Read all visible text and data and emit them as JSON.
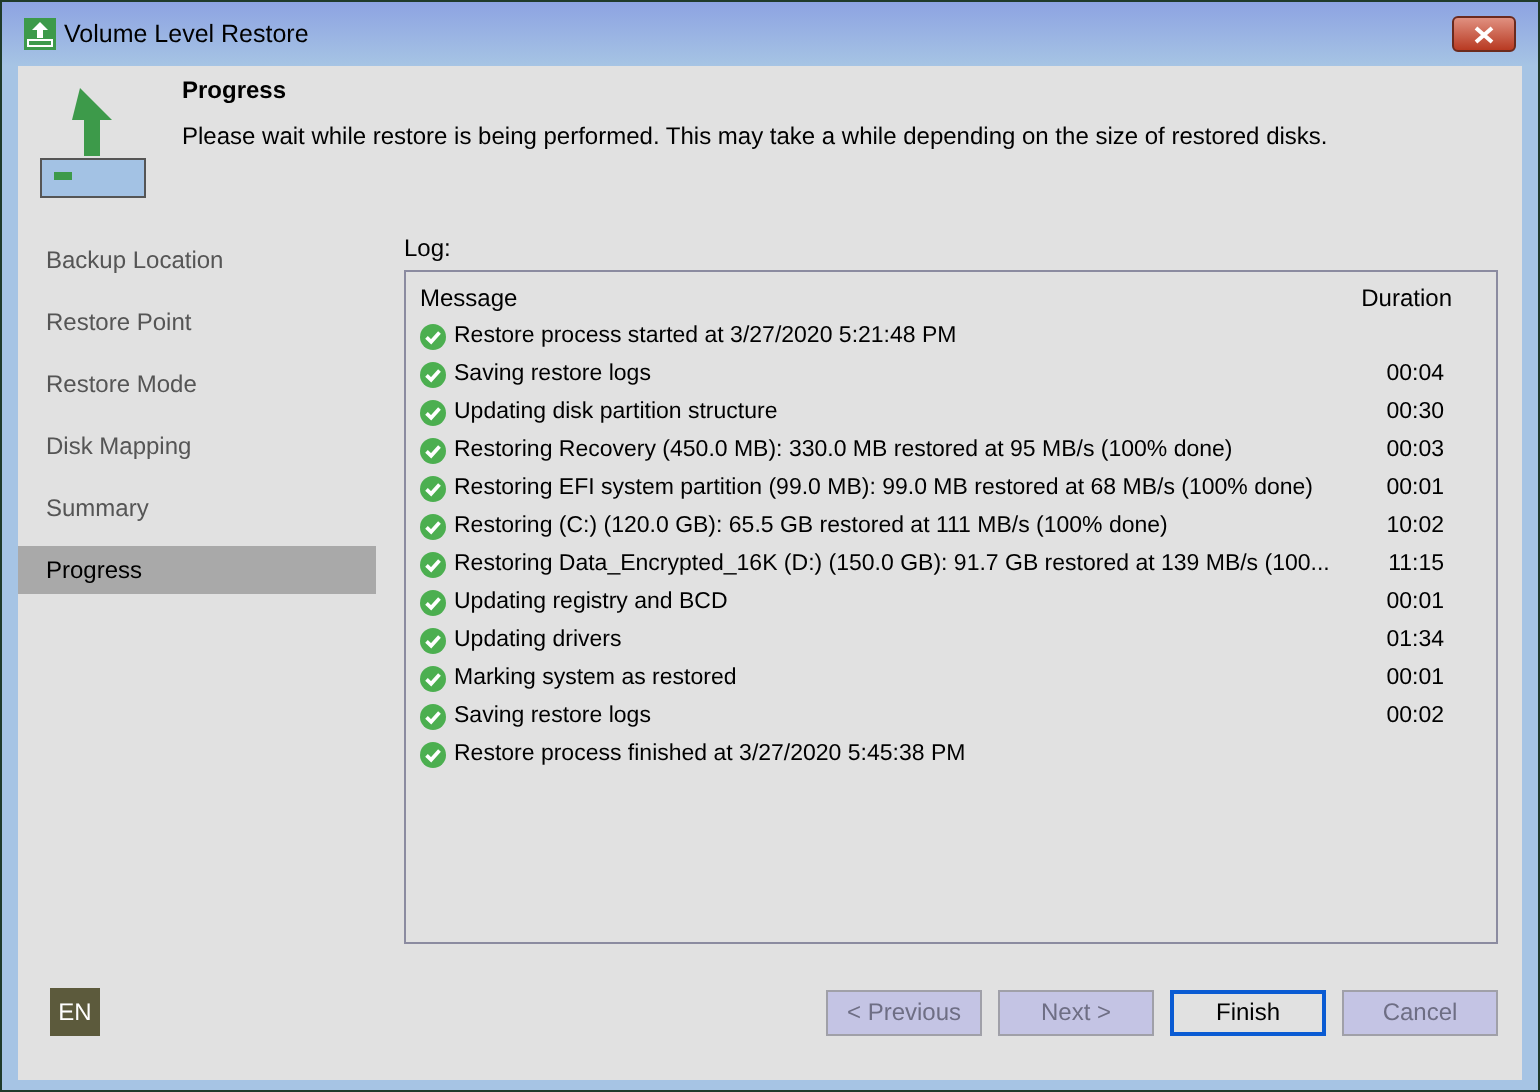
{
  "window": {
    "title": "Volume Level Restore"
  },
  "header": {
    "title": "Progress",
    "subtitle": "Please wait while restore is being performed. This may take a while depending on the size of restored disks."
  },
  "steps": [
    {
      "label": "Backup Location",
      "selected": false
    },
    {
      "label": "Restore Point",
      "selected": false
    },
    {
      "label": "Restore Mode",
      "selected": false
    },
    {
      "label": "Disk Mapping",
      "selected": false
    },
    {
      "label": "Summary",
      "selected": false
    },
    {
      "label": "Progress",
      "selected": true
    }
  ],
  "log": {
    "label": "Log:",
    "columns": [
      "Message",
      "Duration"
    ],
    "rows": [
      {
        "kind": "success",
        "message": "Restore process started at 3/27/2020 5:21:48 PM"
      },
      {
        "kind": "success",
        "message": "Saving restore logs",
        "duration": "00:04"
      },
      {
        "kind": "success",
        "message": "Updating disk partition structure",
        "duration": "00:30"
      },
      {
        "kind": "success",
        "message": "Restoring Recovery (450.0 MB): 330.0 MB restored at 95 MB/s (100% done)",
        "duration": "00:03"
      },
      {
        "kind": "success",
        "message": "Restoring EFI system partition (99.0 MB): 99.0 MB restored at 68 MB/s (100% done)",
        "duration": "00:01"
      },
      {
        "kind": "success",
        "message": "Restoring (C:) (120.0 GB): 65.5 GB restored at 111 MB/s (100% done)",
        "duration": "10:02"
      },
      {
        "kind": "success",
        "message": "Restoring Data_Encrypted_16K (D:) (150.0 GB): 91.7 GB restored at 139 MB/s (100...",
        "duration": "11:15"
      },
      {
        "kind": "success",
        "message": "Updating registry and BCD",
        "duration": "00:01"
      },
      {
        "kind": "success",
        "message": "Updating drivers",
        "duration": "01:34"
      },
      {
        "kind": "success",
        "message": "Marking system as restored",
        "duration": "00:01"
      },
      {
        "kind": "success",
        "message": "Saving restore logs",
        "duration": "00:02"
      },
      {
        "kind": "success",
        "message": "Restore process finished at 3/27/2020 5:45:38 PM"
      }
    ]
  },
  "language": "EN",
  "buttons": [
    {
      "label": "< Previous",
      "disabled": true,
      "default": false
    },
    {
      "label": "Next >",
      "disabled": true,
      "default": false
    },
    {
      "label": "Finish",
      "disabled": false,
      "default": true
    },
    {
      "label": "Cancel",
      "disabled": true,
      "default": false
    }
  ]
}
